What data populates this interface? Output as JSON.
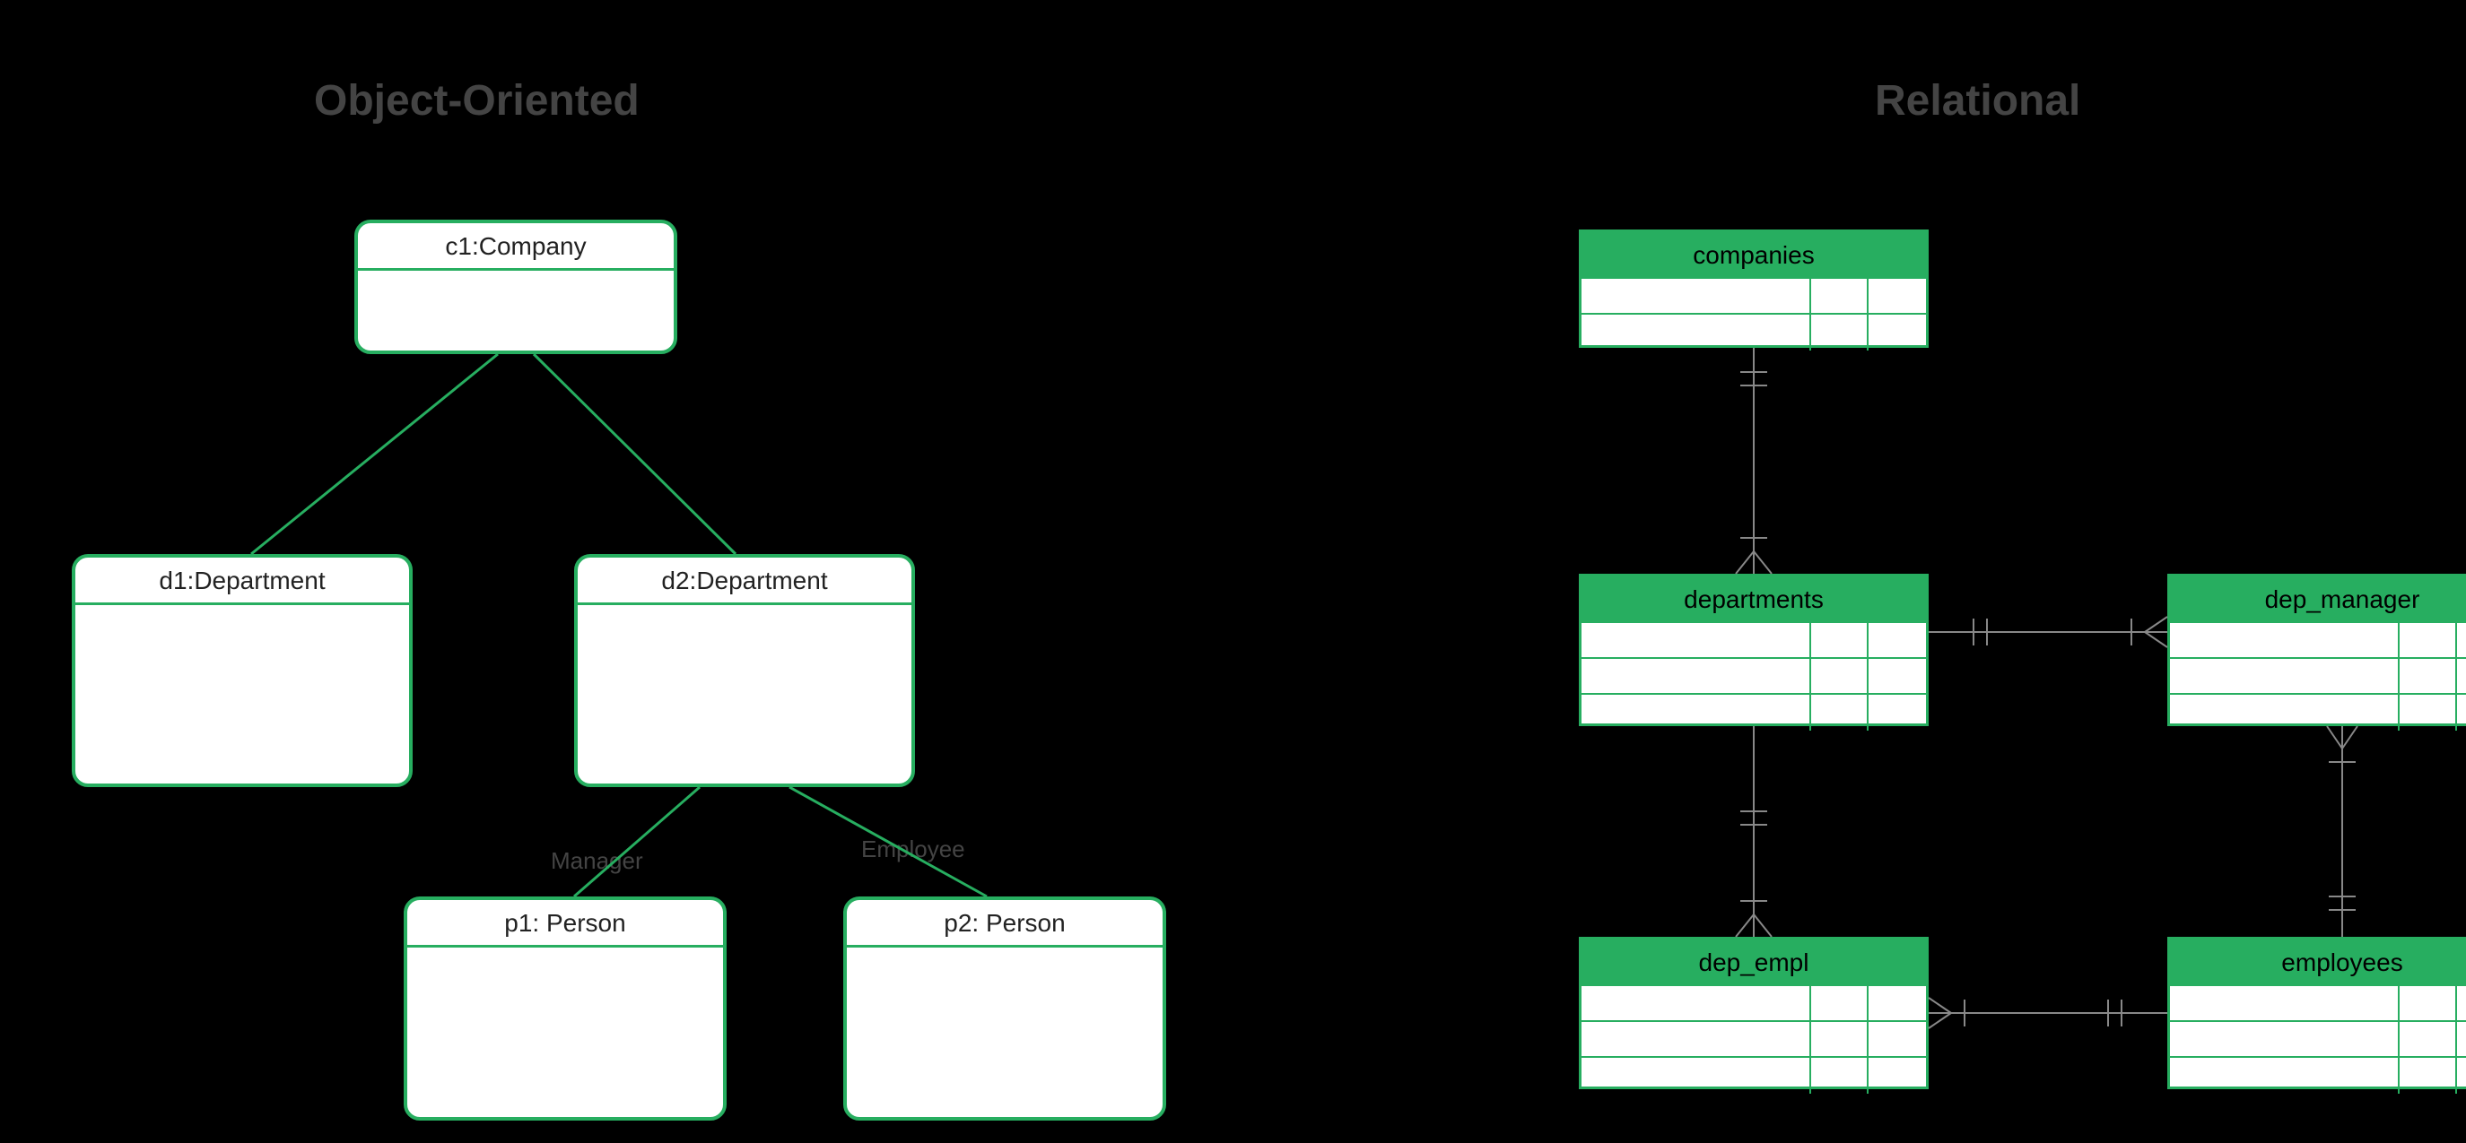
{
  "titles": {
    "left": "Object-Oriented",
    "right": "Relational"
  },
  "oo": {
    "company": {
      "label": "c1:Company"
    },
    "dept1": {
      "label": "d1:Department"
    },
    "dept2": {
      "label": "d2:Department"
    },
    "person1": {
      "label": "p1: Person"
    },
    "person2": {
      "label": "p2: Person"
    },
    "edgeLabels": {
      "manager": "Manager",
      "employee": "Employee"
    }
  },
  "rel": {
    "companies": {
      "label": "companies"
    },
    "departments": {
      "label": "departments"
    },
    "dep_manager": {
      "label": "dep_manager"
    },
    "dep_empl": {
      "label": "dep_empl"
    },
    "employees": {
      "label": "employees"
    }
  },
  "colors": {
    "primary": "#27ae60"
  }
}
